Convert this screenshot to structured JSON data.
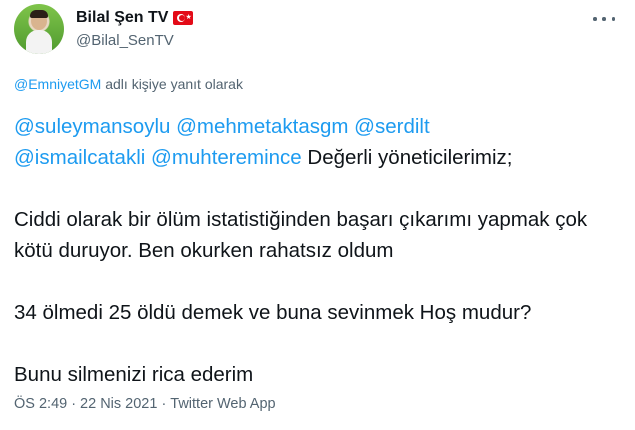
{
  "author": {
    "display_name": "Bilal Şen TV",
    "handle": "@Bilal_SenTV",
    "flag_icon": "turkey-flag-icon"
  },
  "reply_context": {
    "mention": "@EmniyetGM",
    "suffix": "adlı kişiye yanıt olarak"
  },
  "tweet": {
    "mentions": [
      "@suleymansoylu",
      "@mehmetaktasgm",
      "@serdilt",
      "@ismailcatakli",
      "@muhteremince"
    ],
    "line1_text": "Değerli yöneticilerimiz;",
    "paragraph2": "Ciddi olarak bir ölüm istatistiğinden başarı çıkarımı yapmak çok kötü duruyor. Ben okurken rahatsız oldum",
    "paragraph3": "34 ölmedi 25 öldü demek ve buna sevinmek Hoş mudur?",
    "paragraph4": "Bunu silmenizi rica ederim"
  },
  "meta": {
    "time": "ÖS 2:49",
    "separator": "·",
    "date": "22 Nis 2021",
    "source": "Twitter Web App"
  },
  "colors": {
    "link": "#1d9bf0",
    "secondary_text": "#536471",
    "primary_text": "#0f1419"
  }
}
